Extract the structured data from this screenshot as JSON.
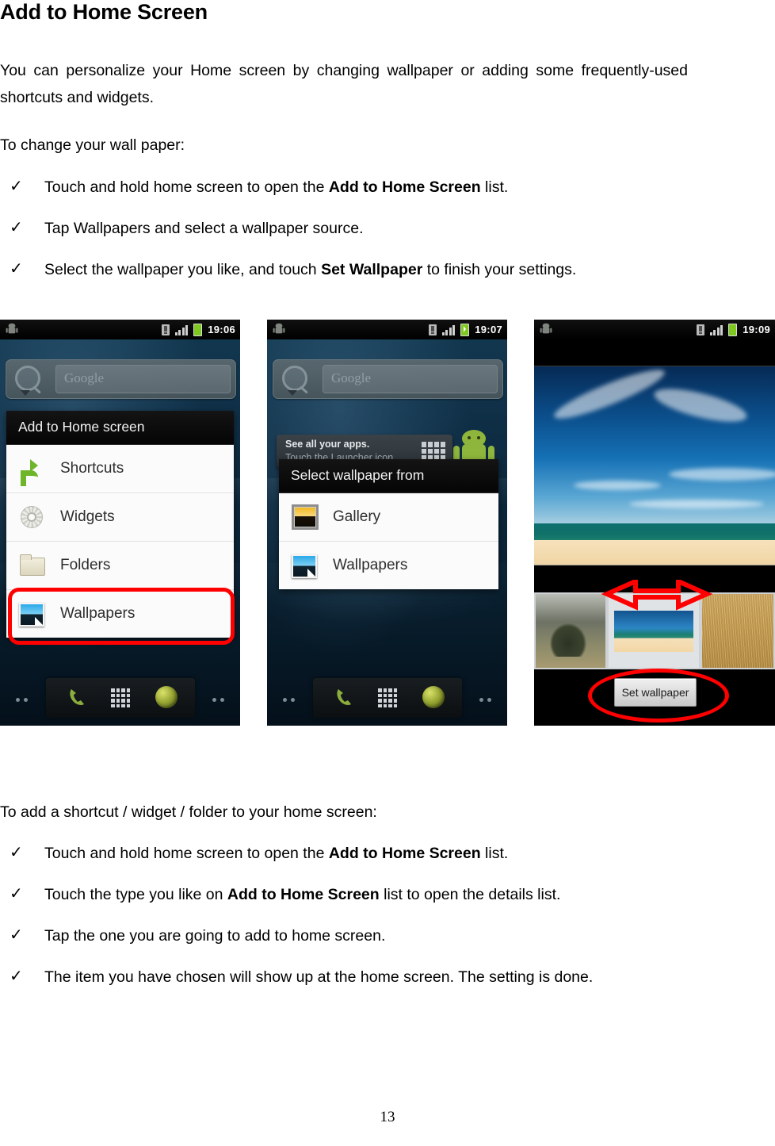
{
  "document": {
    "heading": "Add to Home Screen",
    "page_number": "13",
    "intro_paragraph": "You can personalize your Home screen by changing wallpaper or adding some frequently-used shortcuts and widgets.",
    "section1_lead": "To change your wall paper:",
    "section1_bullets": [
      {
        "bullet": "✓",
        "pre": "Touch and hold home screen to open the ",
        "bold": "Add to Home Screen",
        "post": " list."
      },
      {
        "bullet": "✓",
        "pre": "Tap Wallpapers and select a wallpaper source.",
        "bold": "",
        "post": ""
      },
      {
        "bullet": "✓",
        "pre": "Select the wallpaper you like, and touch ",
        "bold": "Set Wallpaper",
        "post": " to finish your settings."
      }
    ],
    "section2_lead": "To add a shortcut / widget / folder to your home screen:",
    "section2_bullets": [
      {
        "bullet": "✓",
        "pre": "Touch and hold home screen to open the ",
        "bold": "Add to Home Screen",
        "post": " list."
      },
      {
        "bullet": "✓",
        "pre": "Touch the type you like on ",
        "bold": "Add to Home Screen",
        "post": " list to open the details list."
      },
      {
        "bullet": "✓",
        "pre": "Tap the one you are going to add to home screen.",
        "bold": "",
        "post": ""
      },
      {
        "bullet": "✓",
        "pre": "The item you have chosen will show up at the home screen. The setting is done.",
        "bold": "",
        "post": ""
      }
    ]
  },
  "screenshots": {
    "phone1": {
      "status_bar": {
        "time": "19:06",
        "icons": [
          "android-robot-icon",
          "sim-card-icon",
          "signal-bars-icon",
          "battery-icon"
        ]
      },
      "search_widget": {
        "placeholder": "Google",
        "icons": [
          "magnifier-icon",
          "dropdown-caret-icon"
        ]
      },
      "dialog": {
        "title": "Add to Home screen",
        "items": [
          {
            "label": "Shortcuts",
            "icon": "shortcut-arrow-icon"
          },
          {
            "label": "Widgets",
            "icon": "gear-icon"
          },
          {
            "label": "Folders",
            "icon": "folder-icon"
          },
          {
            "label": "Wallpapers",
            "icon": "photo-icon"
          }
        ],
        "highlighted_item": "Wallpapers"
      },
      "dock": {
        "icons": [
          "phone-handset-icon",
          "app-launcher-grid-icon",
          "browser-globe-icon"
        ]
      },
      "annotation_color": "#ff0000"
    },
    "phone2": {
      "status_bar": {
        "time": "19:07",
        "icons": [
          "android-robot-icon",
          "sim-card-icon",
          "signal-bars-icon",
          "battery-charging-icon"
        ]
      },
      "search_widget": {
        "placeholder": "Google",
        "icons": [
          "magnifier-icon",
          "dropdown-caret-icon"
        ]
      },
      "tooltip": {
        "line1": "See all your apps.",
        "line2": "Touch the Launcher icon.",
        "icon": "app-launcher-grid-icon"
      },
      "dialog": {
        "title": "Select wallpaper from",
        "items": [
          {
            "label": "Gallery",
            "icon": "gallery-photo-icon"
          },
          {
            "label": "Wallpapers",
            "icon": "photo-icon"
          }
        ]
      },
      "dock": {
        "icons": [
          "phone-handset-icon",
          "app-launcher-grid-icon",
          "browser-globe-icon"
        ]
      }
    },
    "phone3": {
      "status_bar": {
        "time": "19:09",
        "icons": [
          "android-robot-icon",
          "sim-card-icon",
          "signal-bars-icon",
          "battery-icon"
        ]
      },
      "preview": "beach-wallpaper-preview",
      "thumbnails": [
        "mountain-tree-thumbnail",
        "beach-thumbnail-selected",
        "golden-grass-thumbnail"
      ],
      "selected_thumbnail_index": 1,
      "set_wallpaper_button": "Set wallpaper",
      "annotations": [
        "double-headed-horizontal-arrow",
        "ellipse-around-set-wallpaper"
      ],
      "annotation_color": "#ff0000"
    }
  }
}
